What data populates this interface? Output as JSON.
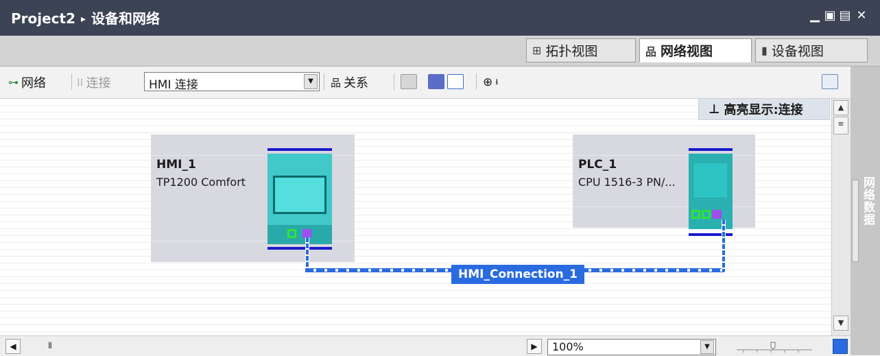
{
  "window": {
    "project": "Project2",
    "breadcrumb_sep": "▸",
    "title": "设备和网络",
    "controls": [
      "minimize-icon",
      "restore-icon",
      "tile-icon",
      "close-icon"
    ]
  },
  "view_tabs": [
    {
      "label": "拓扑视图",
      "icon": "topology-icon",
      "active": false
    },
    {
      "label": "网络视图",
      "icon": "network-icon",
      "active": true
    },
    {
      "label": "设备视图",
      "icon": "device-icon",
      "active": false
    }
  ],
  "toolbar": {
    "network_label": "网络",
    "connect_label": "连接",
    "connection_type": "HMI 连接",
    "relations_label": "关系"
  },
  "highlight": {
    "pin": "ᚹ",
    "text": "高亮显示:连接"
  },
  "devices": [
    {
      "name": "HMI_1",
      "type": "TP1200 Comfort"
    },
    {
      "name": "PLC_1",
      "type": "CPU 1516-3 PN/..."
    }
  ],
  "connection": {
    "label": "HMI_Connection_1"
  },
  "side_pane": {
    "label": "网络数据"
  },
  "bottom": {
    "zoom": "100%"
  },
  "colors": {
    "title_bar": "#3b4354",
    "device_body": "#41c8c8",
    "connection": "#2a6be0",
    "bus_bar": "#1a1acc",
    "port_purple": "#a04ef0",
    "port_green": "#2fe23a"
  }
}
